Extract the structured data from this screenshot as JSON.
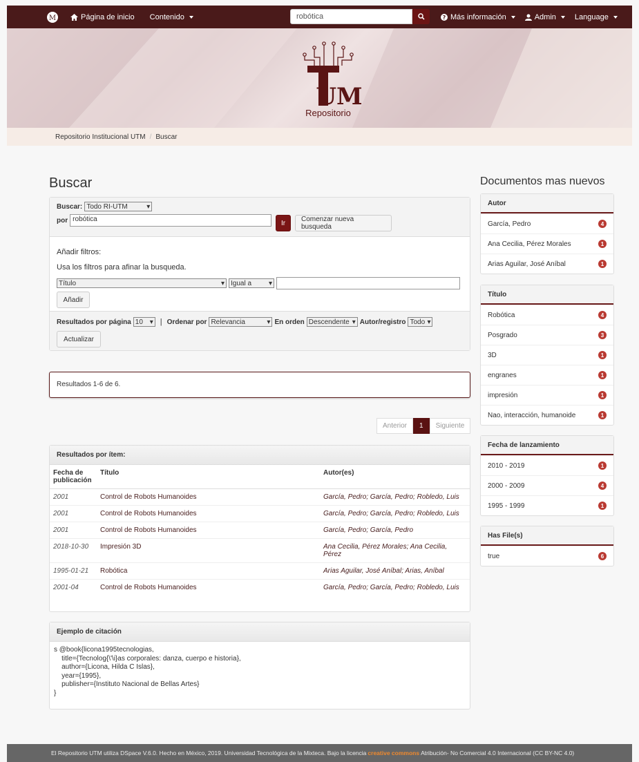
{
  "navbar": {
    "home_label": "Página de inicio",
    "contenido_label": "Contenido",
    "search_value": "robótica",
    "mas_info_label": "Más información",
    "admin_label": "Admin",
    "language_label": "Language"
  },
  "banner": {
    "logo_text": "Repositorio",
    "logo_letters": "UM",
    "logo_t": "T"
  },
  "breadcrumb": {
    "root": "Repositorio Institucional UTM",
    "current": "Buscar"
  },
  "page_title": "Buscar",
  "search": {
    "scope_label": "Buscar:",
    "scope_value": "Todo RI-UTM",
    "query_label": "por",
    "query_value": "robótica",
    "go_label": "Ir",
    "new_search_label": "Comenzar nueva busqueda",
    "filters_heading": "Añadir filtros:",
    "filters_help": "Usa los filtros para afinar la busqueda.",
    "filter_field": "Título",
    "filter_op": "Igual a",
    "filter_value": "",
    "add_label": "Añadir",
    "rpp_label": "Resultados por página",
    "rpp_value": "10",
    "sep": "|",
    "sort_label": "Ordenar por",
    "sort_value": "Relevancia",
    "order_label": "En orden",
    "order_value": "Descendente",
    "etal_label": "Autor/registro",
    "etal_value": "Todo",
    "update_label": "Actualizar"
  },
  "results_summary": "Resultados 1-6 de 6.",
  "pager": {
    "prev": "Anterior",
    "current": "1",
    "next": "Siguiente"
  },
  "items": {
    "heading": "Resultados por ítem:",
    "columns": [
      "Fecha de publicación",
      "Título",
      "Autor(es)"
    ],
    "rows": [
      {
        "date": "2001",
        "title": "Control de Robots Humanoides",
        "authors": "García, Pedro; García, Pedro; Robledo, Luis"
      },
      {
        "date": "2001",
        "title": "Control de Robots Humanoides",
        "authors": "García, Pedro; García, Pedro; Robledo, Luis"
      },
      {
        "date": "2001",
        "title": "Control de Robots Humanoides",
        "authors": "García, Pedro; García, Pedro"
      },
      {
        "date": "2018-10-30",
        "title": "Impresión 3D",
        "authors": "Ana Cecilia, Pérez Morales; Ana Cecilia, Pérez"
      },
      {
        "date": "1995-01-21",
        "title": "Robótica",
        "authors": "Arias Aguilar, José Aníbal; Arias, Aníbal"
      },
      {
        "date": "2001-04",
        "title": "Control de Robots Humanoides",
        "authors": "García, Pedro; García, Pedro; Robledo, Luis"
      }
    ]
  },
  "citation": {
    "heading": "Ejemplo de citación",
    "text": "s @book{licona1995tecnologias,\n    title={Tecnolog{\\'\\i}as corporales: danza, cuerpo e historia},\n    author={Licona, Hilda C Islas},\n    year={1995},\n    publisher={Instituto Nacional de Bellas Artes}\n}"
  },
  "sidebar": {
    "title": "Documentos mas nuevos",
    "facets": [
      {
        "heading": "Autor",
        "items": [
          {
            "label": "García, Pedro",
            "count": "4"
          },
          {
            "label": "Ana Cecilia, Pérez Morales",
            "count": "1"
          },
          {
            "label": "Arias Aguilar, José Aníbal",
            "count": "1"
          }
        ]
      },
      {
        "heading": "Título",
        "items": [
          {
            "label": "Robótica",
            "count": "4"
          },
          {
            "label": "Posgrado",
            "count": "3"
          },
          {
            "label": "3D",
            "count": "1"
          },
          {
            "label": "engranes",
            "count": "1"
          },
          {
            "label": "impresión",
            "count": "1"
          },
          {
            "label": "Nao, interacción, humanoide",
            "count": "1"
          }
        ]
      },
      {
        "heading": "Fecha de lanzamiento",
        "items": [
          {
            "label": "2010 - 2019",
            "count": "1"
          },
          {
            "label": "2000 - 2009",
            "count": "4"
          },
          {
            "label": "1995 - 1999",
            "count": "1"
          }
        ]
      },
      {
        "heading": "Has File(s)",
        "items": [
          {
            "label": "true",
            "count": "6"
          }
        ]
      }
    ]
  },
  "footer": {
    "text_before": "El Repositorio UTM utiliza DSpace V.6.0. Hecho en México, 2019. Universidad Tecnológica de la Mixteca. Bajo la licencia",
    "cc_label": "creative commons",
    "text_after": "Atribución- No Comercial 4.0 Internacional (CC BY-NC 4.0)"
  },
  "colors": {
    "brand": "#4a1a1a",
    "accent": "#7a1515",
    "badge": "#b93a32"
  }
}
